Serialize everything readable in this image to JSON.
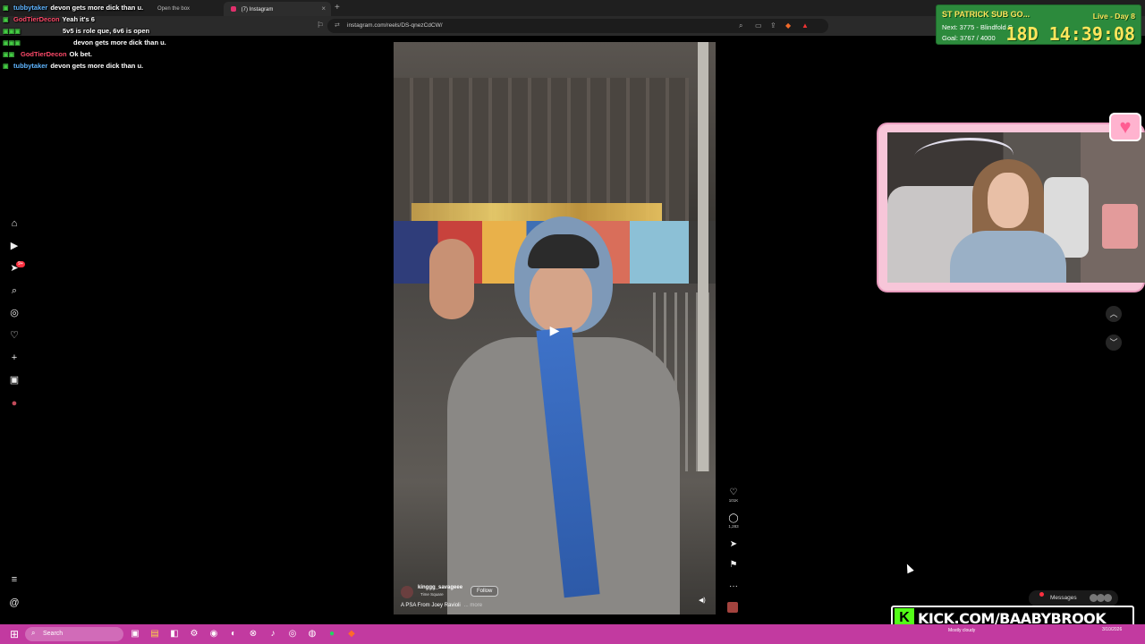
{
  "browser": {
    "tabs": [
      {
        "label": "Open the box"
      },
      {
        "label": "(7) Instagram"
      }
    ],
    "url": "instagram.com/reels/DS-qnezCdCW/"
  },
  "chat": [
    {
      "user": "tubbytaker",
      "user_color": "#5fb5ff",
      "message": "devon gets more dick than u."
    },
    {
      "user": "GodTierDecon",
      "user_color": "#ff4a6a",
      "message": "Yeah it's 6"
    },
    {
      "user": "",
      "user_color": "#ff4a6a",
      "message": "5v5 is role que, 6v6 is open"
    },
    {
      "user": "",
      "user_color": "#ff4a6a",
      "message": "devon gets more dick than u."
    },
    {
      "user": "GodTierDecon",
      "user_color": "#ff4a6a",
      "message": "Ok bet."
    },
    {
      "user": "tubbytaker",
      "user_color": "#5fb5ff",
      "message": "devon gets more dick than u."
    }
  ],
  "sidebar": {
    "items": [
      {
        "name": "home-icon",
        "glyph": "⌂"
      },
      {
        "name": "reels-icon",
        "glyph": "▶"
      },
      {
        "name": "messages-icon",
        "glyph": "➤"
      },
      {
        "name": "search-icon",
        "glyph": "⌕"
      },
      {
        "name": "explore-icon",
        "glyph": "◎"
      },
      {
        "name": "notifications-icon",
        "glyph": "♡"
      },
      {
        "name": "create-icon",
        "glyph": "+"
      },
      {
        "name": "dashboard-icon",
        "glyph": "▣"
      },
      {
        "name": "profile-icon",
        "glyph": "●"
      },
      {
        "name": "menu-icon",
        "glyph": "≡"
      },
      {
        "name": "threads-icon",
        "glyph": "@"
      }
    ],
    "messages_badge": "9+"
  },
  "reel": {
    "username": "kinggg_savageee",
    "location": "Time Square",
    "follow_label": "Follow",
    "caption": "A PSA From Joey Ravioli",
    "more_label": "... more",
    "likes": "101K",
    "comments": "1,283"
  },
  "stream_goal": {
    "title": "ST PATRICK SUB GO...",
    "day": "Live - Day 8",
    "next": "Next: 3775 - Blindfold S",
    "goal": "Goal: 3767 / 4000",
    "timer": "18D 14:39:08"
  },
  "messages_pill": {
    "label": "Messages"
  },
  "kick_banner": {
    "text": "KICK.COM/BAABYBROOK"
  },
  "taskbar": {
    "search_placeholder": "Search",
    "weather": "Mostly cloudy",
    "date": "3/10/2026"
  },
  "colors": {
    "taskbar": "#c23aa0",
    "goal_bg": "#2c8a3c",
    "kick_green": "#53fc18",
    "webcam_frame": "#f7c6d9"
  }
}
